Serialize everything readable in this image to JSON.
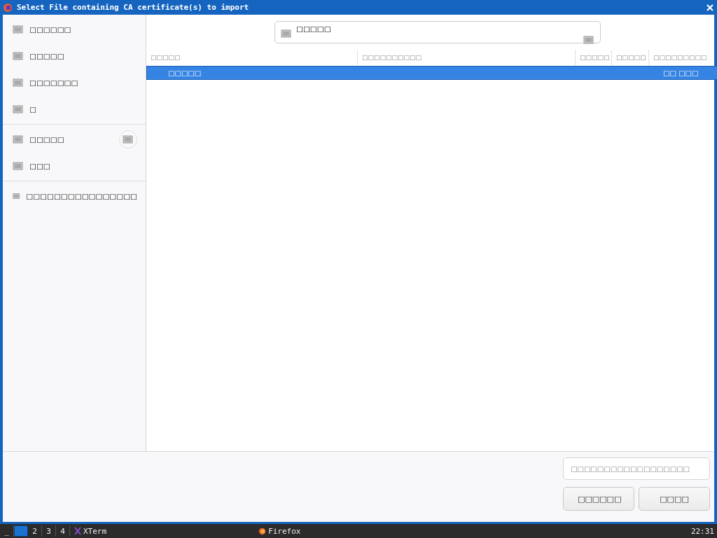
{
  "window": {
    "title": "Select File containing CA certificate(s) to import"
  },
  "sidebar": {
    "groups": [
      [
        {
          "label": "□□□□□□",
          "eject": false
        },
        {
          "label": "□□□□□",
          "eject": false
        },
        {
          "label": "□□□□□□□",
          "eject": false
        },
        {
          "label": "□",
          "eject": false
        }
      ],
      [
        {
          "label": "□□□□□",
          "eject": true
        },
        {
          "label": "□□□",
          "eject": false
        }
      ],
      [
        {
          "label": "□□□□□□□□□□□□□□□□",
          "eject": false
        }
      ]
    ]
  },
  "path_bar": {
    "label": "□□□□□"
  },
  "table": {
    "columns": [
      "□□□□□",
      "□□□□□□□□□□",
      "□□□□□",
      "□□□□□",
      "□□□□□□□□□"
    ],
    "rows": [
      {
        "name": "□□□□□",
        "column_5": "□□ □□□",
        "selected": true
      }
    ]
  },
  "filter": {
    "placeholder": "□□□□□□□□□□□□□□□□□□"
  },
  "buttons": [
    "□□□□□□",
    "□□□□"
  ],
  "taskbar": {
    "workspaces": [
      {
        "selected": true
      },
      {
        "label": "2",
        "selected": false
      },
      {
        "label": "3",
        "selected": false
      },
      {
        "label": "4",
        "selected": false
      }
    ],
    "handle": "_",
    "tasks": [
      "XTerm",
      "Firefox"
    ],
    "clock": "22:31"
  }
}
